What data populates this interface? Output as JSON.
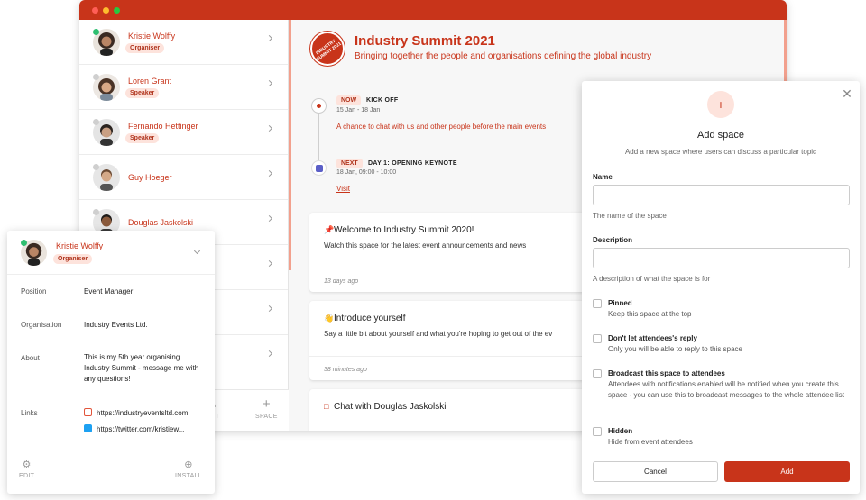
{
  "colors": {
    "accent": "#c8341a",
    "badge_bg": "#fde3dc",
    "online": "#2fbf71",
    "teams": "#5b5fc7"
  },
  "window_controls": [
    {
      "name": "close",
      "color": "#ff5f57"
    },
    {
      "name": "minimize",
      "color": "#febc2e"
    },
    {
      "name": "maximize",
      "color": "#28c840"
    }
  ],
  "people": [
    {
      "name": "Kristie Wolffy",
      "role": "Organiser",
      "online": true
    },
    {
      "name": "Loren Grant",
      "role": "Speaker",
      "online": false
    },
    {
      "name": "Fernando Hettinger",
      "role": "Speaker",
      "online": false
    },
    {
      "name": "Guy Hoeger",
      "role": "",
      "online": false
    },
    {
      "name": "Douglas Jaskolski",
      "role": "",
      "online": false
    }
  ],
  "people_footer": {
    "edit_label": "EDIT",
    "space_label": "SPACE"
  },
  "event": {
    "logo_text": "INDUSTRY SUMMIT 2021",
    "title": "Industry Summit 2021",
    "subtitle": "Bringing together the people and organisations defining the global industry"
  },
  "timeline": [
    {
      "tag": "NOW",
      "title": "KICK OFF",
      "date": "15 Jan - 18 Jan",
      "description": "A chance to chat with us and other people before the main events"
    },
    {
      "tag": "NEXT",
      "title": "DAY 1: OPENING KEYNOTE",
      "date": "18 Jan, 09:00 - 10:00",
      "link": "Visit"
    }
  ],
  "cards": [
    {
      "icon": "pin-icon",
      "title": "Welcome to Industry Summit 2020!",
      "body": "Watch this space for the latest event announcements and news",
      "time": "13 days ago"
    },
    {
      "icon": "wave-icon",
      "title": "Introduce yourself",
      "body": "Say a little bit about yourself and what you're hoping to get out of the ev",
      "time": "38 minutes ago"
    },
    {
      "icon": "chat-icon",
      "title": "Chat with Douglas Jaskolski",
      "body": "",
      "time": ""
    }
  ],
  "profile": {
    "name": "Kristie Wolffy",
    "role": "Organiser",
    "fields": [
      {
        "label": "Position",
        "value": "Event Manager"
      },
      {
        "label": "Organisation",
        "value": "Industry Events Ltd."
      },
      {
        "label": "About",
        "value": "This is my 5th year organising Industry Summit - message me with any questions!"
      }
    ],
    "links_label": "Links",
    "links": [
      {
        "icon": "external-link-icon",
        "text": "https://industryeventsltd.com"
      },
      {
        "icon": "twitter-icon",
        "text": "https://twitter.com/kristiew..."
      }
    ],
    "footer": {
      "edit_label": "EDIT",
      "install_label": "INSTALL"
    }
  },
  "dialog": {
    "title": "Add space",
    "subtitle": "Add a new space where users can discuss a particular topic",
    "name_label": "Name",
    "name_value": "",
    "name_help": "The name of the space",
    "description_label": "Description",
    "description_value": "",
    "description_help": "A description of what the space is for",
    "options": [
      {
        "label": "Pinned",
        "help": "Keep this space at the top",
        "checked": false
      },
      {
        "label": "Don't let attendees's reply",
        "help": "Only you will be able to reply to this space",
        "checked": false
      },
      {
        "label": "Broadcast this space to attendees",
        "help": "Attendees with notifications enabled will be notified when you create this space - you can use this to broadcast messages to the whole attendee list",
        "checked": false
      },
      {
        "label": "Hidden",
        "help": "Hide from event attendees",
        "checked": false
      }
    ],
    "cancel_label": "Cancel",
    "add_label": "Add"
  }
}
